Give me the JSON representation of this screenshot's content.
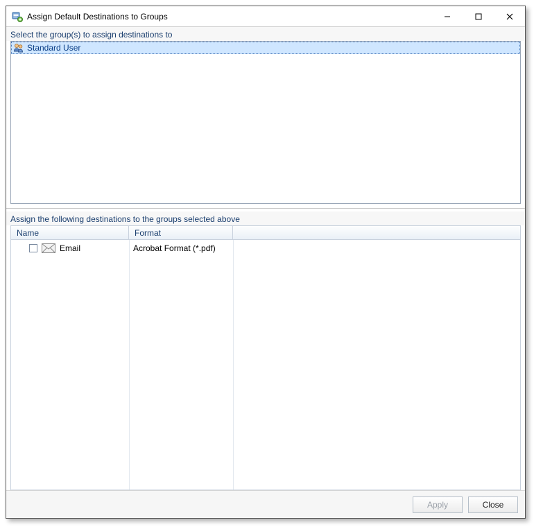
{
  "window": {
    "title": "Assign Default Destinations to Groups"
  },
  "sections": {
    "groups_label": "Select the group(s) to assign destinations to",
    "destinations_label": "Assign the following destinations to the groups selected above"
  },
  "groups": [
    {
      "label": "Standard User",
      "selected": true
    }
  ],
  "dest_columns": {
    "name": "Name",
    "format": "Format"
  },
  "destinations": [
    {
      "checked": false,
      "name": "Email",
      "format": "Acrobat Format (*.pdf)"
    }
  ],
  "buttons": {
    "apply": "Apply",
    "close": "Close",
    "apply_enabled": false
  }
}
